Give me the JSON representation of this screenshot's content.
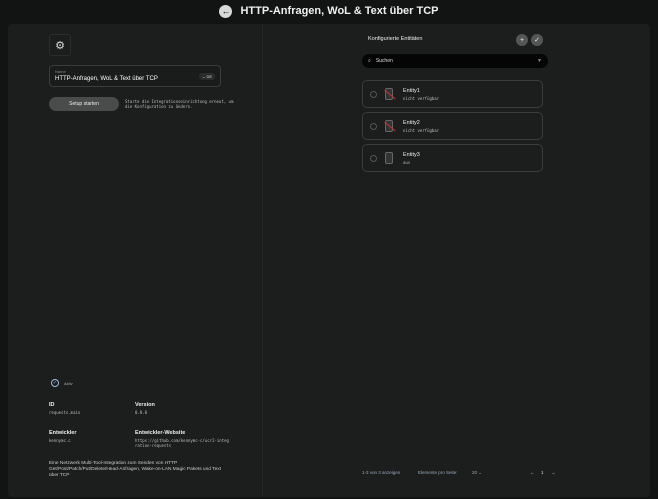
{
  "header": {
    "title": "HTTP-Anfragen, WoL & Text über TCP"
  },
  "integration": {
    "name_label": "Name",
    "name_value": "HTTP-Anfragen, WoL & Text über TCP",
    "language": "DE",
    "setup_button": "Setup starten",
    "setup_description": "Starte die Integrationseinrichtung erneut, um die Konfiguration zu ändern.",
    "status": "Aktiv",
    "id_label": "ID",
    "id_value": "requests.main",
    "version_label": "Version",
    "version_value": "0.8.8",
    "developer_label": "Entwickler",
    "developer_value": "kennymc.c",
    "website_label": "Entwickler-Website",
    "website_value": "https://github.com/kennymc-c/ucr2-integration-requests",
    "description": "Eine Netzwerk Multi-Tool-Integration zum Senden von HTTP Get/Post/Patch/Put/Delete/Head-Anfragen, Wake-on-LAN Magic Pakets und Text über TCP"
  },
  "entities": {
    "title": "Konfigurierte Entitäten",
    "search_placeholder": "Suchen",
    "items": [
      {
        "name": "Entity1",
        "state": "nicht verfügbar",
        "unavailable": true
      },
      {
        "name": "Entity2",
        "state": "nicht verfügbar",
        "unavailable": true
      },
      {
        "name": "Entity3",
        "state": "aus",
        "unavailable": false
      }
    ],
    "pagination": {
      "summary": "1-3 von 3 anzeigen",
      "per_page_label": "Elemente pro Seite:",
      "per_page": "20",
      "page": "1"
    }
  }
}
